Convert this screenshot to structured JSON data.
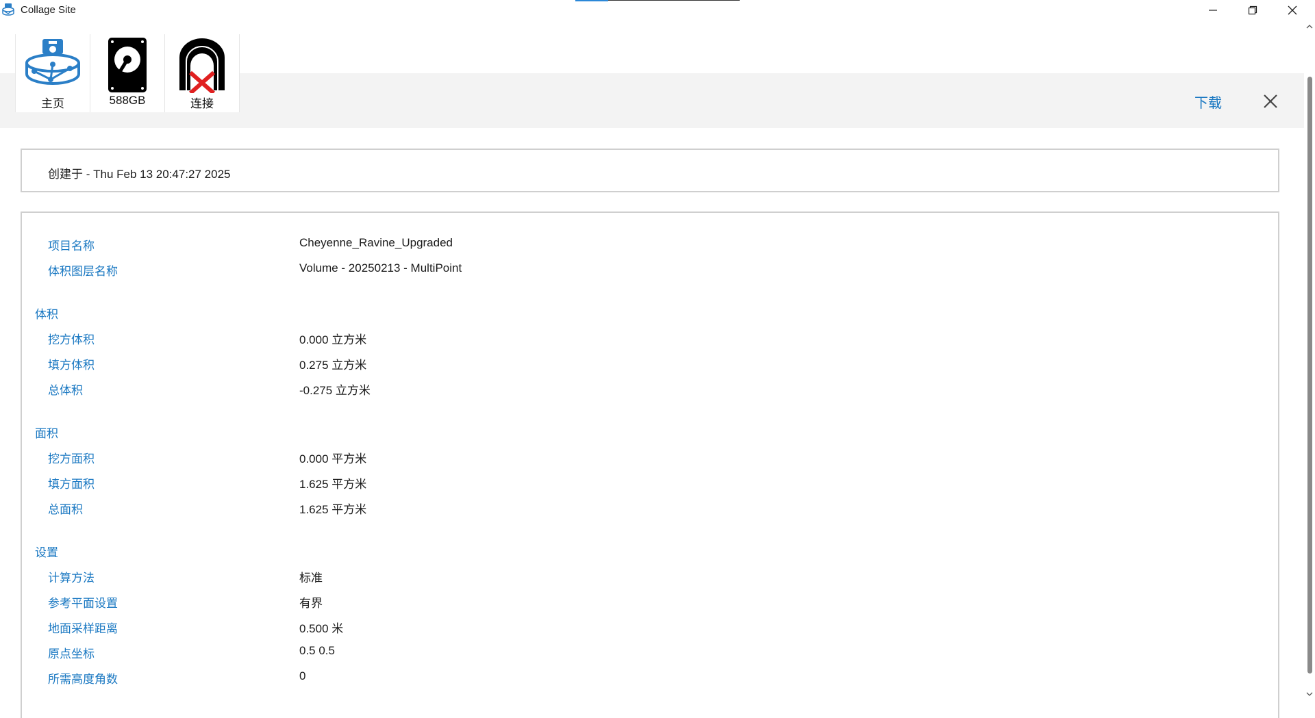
{
  "window": {
    "title": "Collage Site",
    "icons": {
      "app": "site-globe-icon",
      "minimize": "minimize-icon",
      "maximize": "restore-icon",
      "close": "close-icon"
    }
  },
  "toolbar": {
    "items": [
      {
        "label": "主页",
        "icon": "home-site-icon"
      },
      {
        "label": "588GB",
        "icon": "hard-drive-icon"
      },
      {
        "label": "连接",
        "icon": "scanner-disconnected-icon"
      }
    ],
    "download_label": "下载",
    "close_icon": "close-icon"
  },
  "created": {
    "text": "创建于 - Thu Feb 13 20:47:27 2025"
  },
  "details": {
    "project_name": {
      "label": "项目名称",
      "value": "Cheyenne_Ravine_Upgraded"
    },
    "volume_layer_name": {
      "label": "体积图层名称",
      "value": "Volume - 20250213 - MultiPoint"
    },
    "volume": {
      "title": "体积",
      "rows": [
        {
          "label": "挖方体积",
          "value": "0.000 立方米"
        },
        {
          "label": "填方体积",
          "value": "0.275 立方米"
        },
        {
          "label": "总体积",
          "value": "-0.275 立方米"
        }
      ]
    },
    "area": {
      "title": "面积",
      "rows": [
        {
          "label": "挖方面积",
          "value": "0.000 平方米"
        },
        {
          "label": "填方面积",
          "value": "1.625 平方米"
        },
        {
          "label": "总面积",
          "value": "1.625 平方米"
        }
      ]
    },
    "settings": {
      "title": "设置",
      "rows": [
        {
          "label": "计算方法",
          "value": "标准"
        },
        {
          "label": "参考平面设置",
          "value": "有界"
        },
        {
          "label": "地面采样距离",
          "value": "0.500 米"
        },
        {
          "label": "原点坐标",
          "value": "0.5 0.5"
        },
        {
          "label": "所需高度角数",
          "value": "0"
        }
      ]
    }
  },
  "colors": {
    "accent": "#1a78c2",
    "band": "#f3f3f3",
    "border": "#cfcfcf",
    "alert": "#e02020"
  }
}
